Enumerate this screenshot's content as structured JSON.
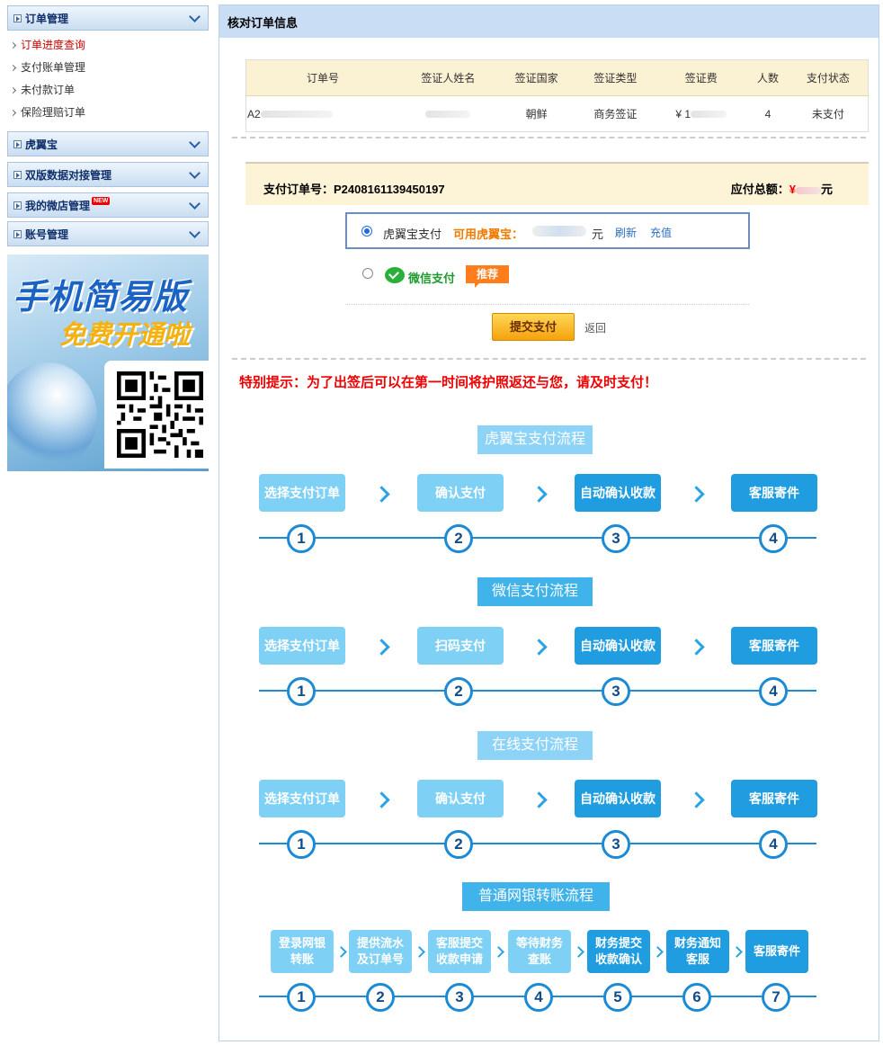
{
  "sidebar": {
    "menus": [
      {
        "label": "订单管理",
        "items": [
          "订单进度查询",
          "支付账单管理",
          "未付款订单",
          "保险理赔订单"
        ]
      },
      {
        "label": "虎翼宝"
      },
      {
        "label": "双版数据对接管理"
      },
      {
        "label": "我的微店管理",
        "badge": "NEW"
      },
      {
        "label": "账号管理"
      }
    ],
    "promo": {
      "line1": "手机简易版",
      "line2": "免费开通啦"
    }
  },
  "main": {
    "title": "核对订单信息",
    "table": {
      "headers": [
        "订单号",
        "签证人姓名",
        "签证国家",
        "签证类型",
        "签证费",
        "人数",
        "支付状态"
      ],
      "row": {
        "order_no": "A2",
        "country": "朝鲜",
        "type": "商务签证",
        "fee": "¥ 1",
        "count": "4",
        "status": "未支付"
      }
    },
    "pay": {
      "order_label": "支付订单号：P2408161139450197",
      "total_label": "应付总额：",
      "total_prefix": "¥",
      "total_unit": "元"
    },
    "options": {
      "huyibao": {
        "label": "虎翼宝支付",
        "available": "可用虎翼宝：",
        "unit": "元",
        "refresh": "刷新",
        "recharge": "充值"
      },
      "wechat": {
        "label": "微信支付",
        "badge": "推荐"
      }
    },
    "submit": "提交支付",
    "back": "返回",
    "tip": "特别提示：为了出签后可以在第一时间将护照返还与您，请及时支付！",
    "flows": [
      {
        "title": "虎翼宝支付流程",
        "steps": [
          "选择支付订单",
          "确认支付",
          "自动确认收款",
          "客服寄件"
        ]
      },
      {
        "title": "微信支付流程",
        "steps": [
          "选择支付订单",
          "扫码支付",
          "自动确认收款",
          "客服寄件"
        ]
      },
      {
        "title": "在线支付流程",
        "steps": [
          "选择支付订单",
          "确认支付",
          "自动确认收款",
          "客服寄件"
        ]
      },
      {
        "title": "普通网银转账流程",
        "steps": [
          [
            "登录网银",
            "转账"
          ],
          [
            "提供流水",
            "及订单号"
          ],
          [
            "客服提交",
            "收款申请"
          ],
          [
            "等待财务",
            "查账"
          ],
          [
            "财务提交",
            "收款确认"
          ],
          [
            "财务通知",
            "客服"
          ],
          [
            "客服寄件"
          ]
        ]
      }
    ],
    "numbers": [
      "1",
      "2",
      "3",
      "4",
      "5",
      "6",
      "7"
    ]
  }
}
